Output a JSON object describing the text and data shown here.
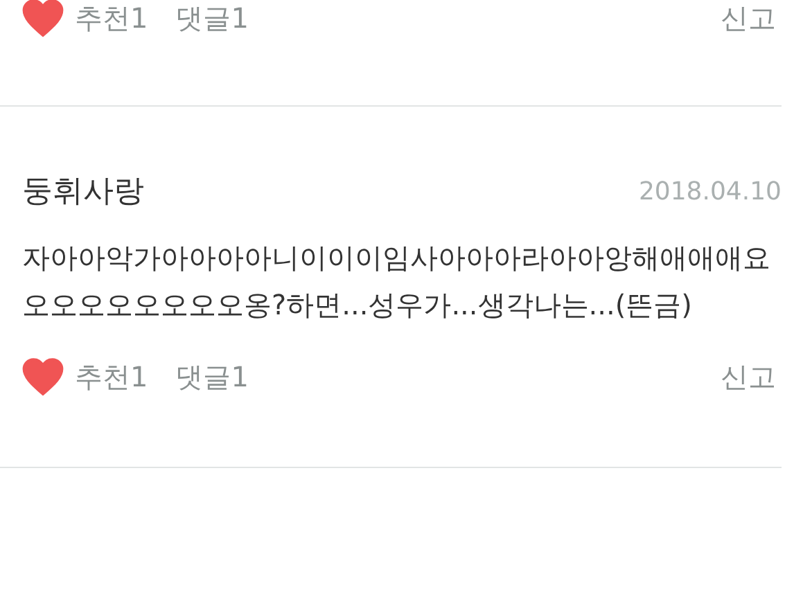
{
  "previous_comment_actions": {
    "liked": true,
    "recommend": "추천1",
    "replies": "댓글1",
    "report": "신고"
  },
  "comment": {
    "author": "둥휘사랑",
    "date": "2018.04.10",
    "text": "자아아악가아아아아니이이이임사아아아라아아앙해애애애요오오오오오오오오옹?하면...성우가...생각나는...(뜬금)",
    "actions": {
      "liked": true,
      "recommend": "추천1",
      "replies": "댓글1",
      "report": "신고"
    }
  }
}
